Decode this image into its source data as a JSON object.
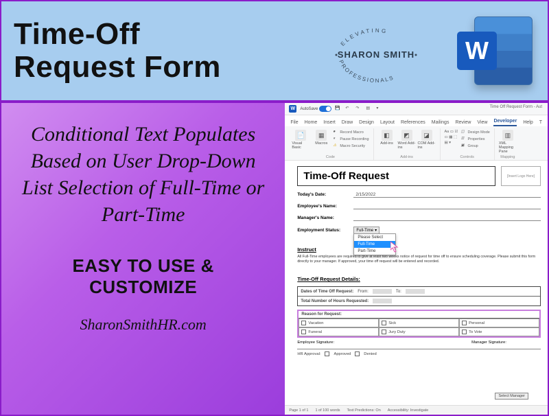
{
  "banner": {
    "title_line1": "Time-Off",
    "title_line2": "Request Form",
    "brand_top": "ELEVATING",
    "brand_name": "SHARON SMITH",
    "brand_bottom": "PROFESSIONALS",
    "word_letter": "W"
  },
  "promo": {
    "description": "Conditional Text Populates Based on User Drop-Down List Selection of Full-Time or Part-Time",
    "callout_line1": "EASY TO USE &",
    "callout_line2": "CUSTOMIZE",
    "website": "SharonSmithHR.com"
  },
  "word_app": {
    "autosave_label": "AutoSave",
    "autosave_state": "On",
    "title_filename": "Time Off Request Form - Aut",
    "tabs": [
      "File",
      "Home",
      "Insert",
      "Draw",
      "Design",
      "Layout",
      "References",
      "Mailings",
      "Review",
      "View",
      "Developer",
      "Help",
      "T"
    ],
    "active_tab": "Developer",
    "ribbon_groups": {
      "code": {
        "visual_basic": "Visual Basic",
        "macros": "Macros",
        "record_macro": "Record Macro",
        "pause_recording": "Pause Recording",
        "macro_security": "Macro Security",
        "label": "Code"
      },
      "addins": {
        "addins": "Add-ins",
        "word_addins": "Word Add-ins",
        "com_addins": "COM Add-ins",
        "label": "Add-ins"
      },
      "controls": {
        "design_mode": "Design Mode",
        "properties": "Properties",
        "group": "Group",
        "label": "Controls"
      },
      "mapping": {
        "xml_mapping": "XML Mapping Pane",
        "label": "Mapping"
      }
    }
  },
  "form": {
    "title": "Time-Off Request",
    "logo_placeholder": "[Insert Logo Here]",
    "fields": {
      "date_label": "Today's Date:",
      "date_value": "2/15/2022",
      "employee_label": "Employee's Name:",
      "manager_label": "Manager's Name:",
      "status_label": "Employment Status:",
      "status_selected": "Full-Time",
      "dropdown": [
        "Please Select",
        "Full-Time",
        "Part-Time"
      ]
    },
    "instructions_heading": "Instruct",
    "instructions_body": "All Full-Time employees are required to give at least two weeks notice of request for time off to ensure scheduling coverage. Please submit this form directly to your manager. If approved, your time off request will be entered and recorded.",
    "details_heading": "Time-Off Request Details:",
    "dates_label": "Dates of Time Off Request:",
    "from_label": "From:",
    "to_label": "To:",
    "hours_label": "Total Number of Hours Requested:",
    "reason_heading": "Reason for Request:",
    "reasons": [
      "Vacation",
      "Sick",
      "Personal",
      "Funeral",
      "Jury Duty",
      "To Vote"
    ],
    "emp_sig": "Employee Signature:",
    "mgr_sig": "Manager Signature:",
    "hr_approval": "HR Approval:",
    "approved": "Approved",
    "denied": "Denied",
    "select_manager": "Select Manager"
  },
  "statusbar": {
    "page": "Page 1 of 1",
    "words": "1 of 100 words",
    "predictions": "Text Predictions: On",
    "accessibility": "Accessibility: Investigate"
  }
}
